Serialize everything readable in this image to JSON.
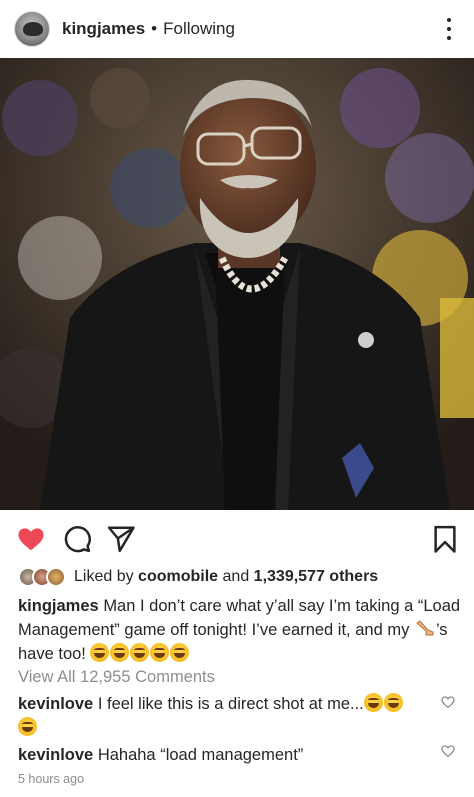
{
  "post": {
    "username": "kingjames",
    "separator": "•",
    "follow_state": "Following"
  },
  "likes": {
    "prefix": "Liked by",
    "first_liker": "coomobile",
    "middle": "and",
    "count_text": "1,339,577 others"
  },
  "caption": {
    "username": "kingjames",
    "text_part1": "Man I don’t care what y’all say I’m taking a “Load Management” game off tonight! I’ve earned it, and my",
    "text_part2": "’s have too!"
  },
  "view_all": "View All 12,955 Comments",
  "comments": [
    {
      "username": "kevinlove",
      "text": "I feel like this is a direct shot at me..."
    },
    {
      "username": "kevinlove",
      "text": "Hahaha “load management”"
    }
  ],
  "timestamp": "5 hours ago",
  "icons": {
    "like": "heart-filled-icon",
    "comment": "comment-bubble-icon",
    "share": "send-paper-plane-icon",
    "save": "bookmark-icon",
    "more": "more-vertical-icon"
  },
  "colors": {
    "like_red": "#ed4956",
    "text": "#262626",
    "muted": "#8e8e8e"
  }
}
